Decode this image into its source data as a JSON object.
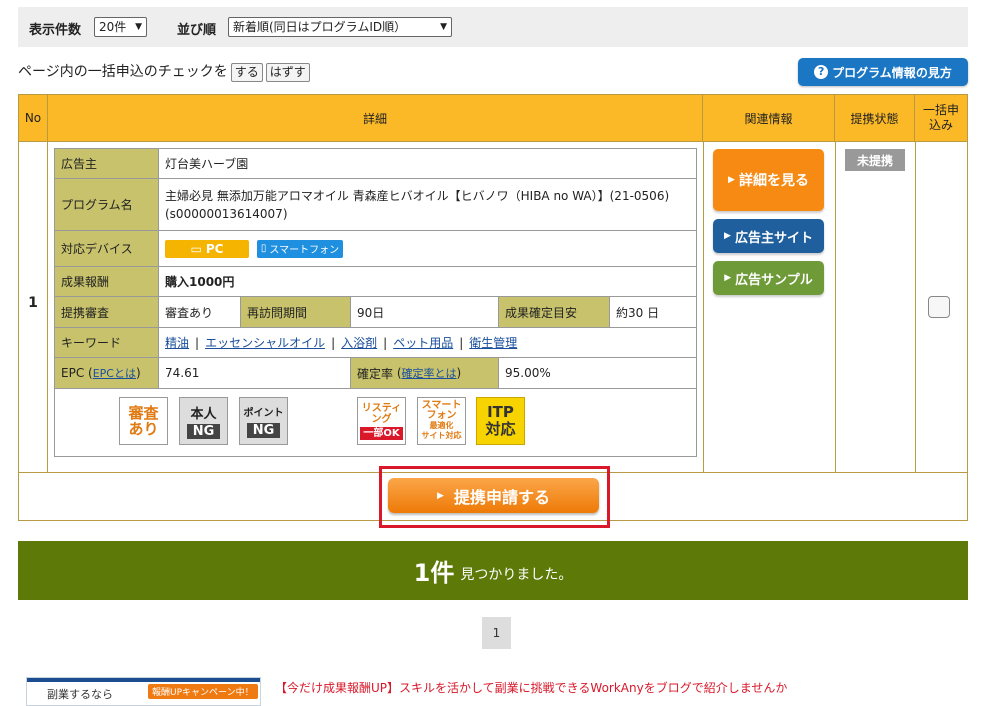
{
  "filter": {
    "count_label": "表示件数",
    "count_value": "20件",
    "sort_label": "並び順",
    "sort_value": "新着順(同日はプログラムID順）"
  },
  "bulk": {
    "text": "ページ内の一括申込のチェックを",
    "on_label": "する",
    "off_label": "はずす"
  },
  "info_button": {
    "icon": "?",
    "label": "プログラム情報の見方"
  },
  "table": {
    "headers": {
      "no": "No",
      "detail": "詳細",
      "related": "関連情報",
      "status": "提携状態",
      "bulk": "一括申込み"
    },
    "row": {
      "no": "1",
      "advertiser_label": "広告主",
      "advertiser": "灯台美ハーブ園",
      "program_label": "プログラム名",
      "program": "主婦必見 無添加万能アロマオイル 青森産ヒバオイル【ヒバノワ（HIBA no WA）】(21-0506)(s00000013614007)",
      "device_label": "対応デバイス",
      "device_pc": "PC",
      "device_sp": "スマートフォン",
      "reward_label": "成果報酬",
      "reward": "購入1000円",
      "review_label": "提携審査",
      "review": "審査あり",
      "revisit_label": "再訪問期間",
      "revisit": "90日",
      "confirm_label": "成果確定目安",
      "confirm": "約30 日",
      "keyword_label": "キーワード",
      "keywords": [
        "精油",
        "エッセンシャルオイル",
        "入浴剤",
        "ペット用品",
        "衛生管理"
      ],
      "epc_label": "EPC",
      "epc_link": "EPCとは",
      "epc": "74.61",
      "rate_label": "確定率",
      "rate_link": "確定率とは",
      "rate": "95.00%",
      "badges": {
        "review_top": "審査",
        "review_bottom": "あり",
        "self_top": "本人",
        "self_bottom": "NG",
        "point_top": "ポイント",
        "point_bottom": "NG",
        "listing_l1": "リスティ",
        "listing_l2": "ング",
        "listing_l3": "一部OK",
        "smart_l1": "スマート",
        "smart_l2": "フォン",
        "smart_l3": "最適化",
        "smart_l4": "サイト対応",
        "itp_l1": "ITP",
        "itp_l2": "対応"
      },
      "detail_button": "詳細を見る",
      "advertiser_site_button": "広告主サイト",
      "ad_sample_button": "広告サンプル",
      "status": "未提携"
    },
    "apply_button": "提携申請する"
  },
  "result": {
    "count": "1件",
    "text": "見つかりました。"
  },
  "pager": {
    "current": "1"
  },
  "promo": {
    "img_l1": "副業するなら",
    "img_badge": "報酬UPキャンペーン中！",
    "text": "【今だけ成果報酬UP】スキルを活かして副業に挑戦できるWorkAnyをブログで紹介しませんか"
  },
  "colors": {
    "header": "#fbb927",
    "label_bg": "#c7c26b",
    "banner": "#5d7908",
    "apply": "#f28a16",
    "highlight": "#d9182a"
  }
}
